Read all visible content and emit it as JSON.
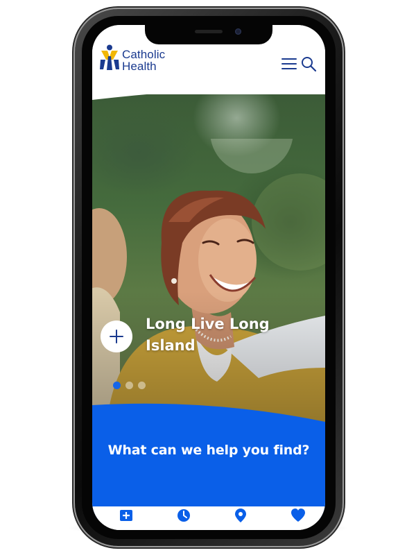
{
  "brand": {
    "name_line1": "Catholic",
    "name_line2": "Health",
    "primary_color": "#0a5fe8",
    "logo_blue": "#1a3a8f",
    "logo_yellow": "#f2b705"
  },
  "header": {
    "icons": [
      "menu-icon",
      "search-icon"
    ]
  },
  "hero": {
    "title": "Long Live Long Island",
    "carousel_total": 3,
    "carousel_active": 1
  },
  "find": {
    "title": "What can we help you find?"
  },
  "bottom_nav": {
    "icons": [
      "medical-plus-icon",
      "clock-icon",
      "location-pin-icon",
      "heart-icon"
    ]
  }
}
